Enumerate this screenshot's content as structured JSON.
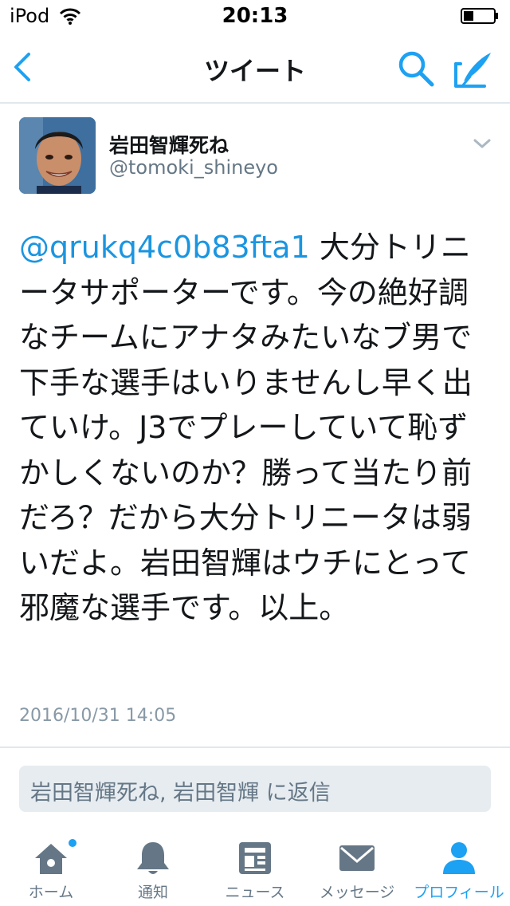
{
  "status_bar": {
    "carrier": "iPod",
    "time": "20:13"
  },
  "nav": {
    "title": "ツイート"
  },
  "tweet": {
    "display_name": "岩田智輝死ね",
    "handle": "@tomoki_shineyo",
    "mention": "@qrukq4c0b83fta1",
    "text": " 大分トリニータサポーターです。今の絶好調なチームにアナタみたいなブ男で下手な選手はいりませんし早く出ていけ。J3でプレーしていて恥ずかしくないのか？勝って当たり前だろ？だから大分トリニータは弱いだよ。岩田智輝はウチにとって邪魔な選手です。以上。",
    "timestamp": "2016/10/31 14:05"
  },
  "reply": {
    "placeholder": "岩田智輝死ね, 岩田智輝 に返信"
  },
  "tabs": [
    {
      "label": "ホーム",
      "icon": "home-icon",
      "active": false,
      "badge": true
    },
    {
      "label": "通知",
      "icon": "bell-icon",
      "active": false
    },
    {
      "label": "ニュース",
      "icon": "news-icon",
      "active": false
    },
    {
      "label": "メッセージ",
      "icon": "envelope-icon",
      "active": false
    },
    {
      "label": "プロフィール",
      "icon": "person-icon",
      "active": true
    }
  ],
  "colors": {
    "accent": "#1da1f2",
    "mention": "#1b95e0",
    "inactive": "#657786",
    "reply_bg": "#e6ecf0"
  }
}
